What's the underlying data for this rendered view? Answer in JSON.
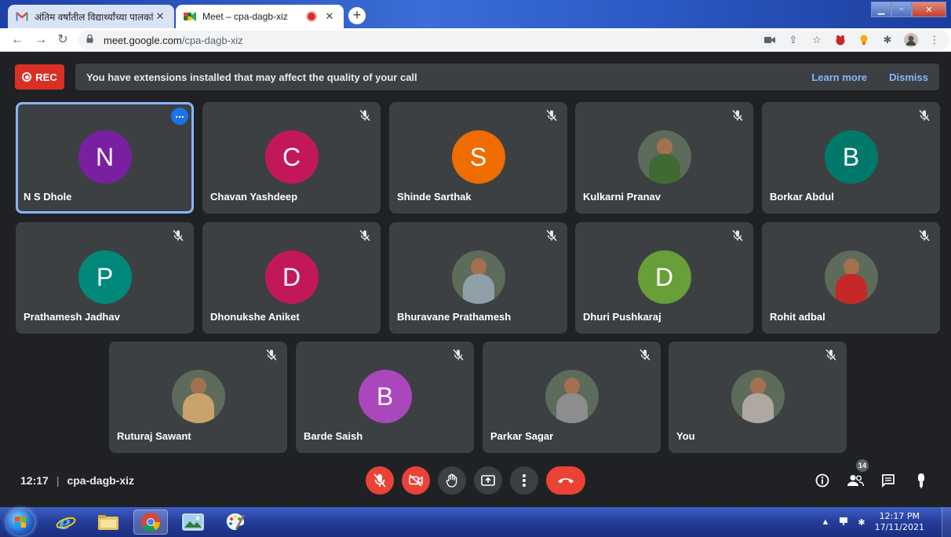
{
  "browser": {
    "tabs": [
      {
        "title": "अंतिम वर्षांतील विद्यार्थ्यांच्या पालकां",
        "icon": "gmail-icon"
      },
      {
        "title": "Meet – cpa-dagb-xiz",
        "icon": "meet-icon"
      }
    ],
    "url_host": "meet.google.com",
    "url_path": "/cpa-dagb-xiz"
  },
  "meet": {
    "rec_label": "REC",
    "banner": {
      "message": "You have extensions installed that may affect the quality of your call",
      "learn_more": "Learn more",
      "dismiss": "Dismiss"
    },
    "participants": [
      {
        "name": "N S Dhole",
        "initial": "N",
        "color": "#7b1fa2",
        "photo": false,
        "active": true
      },
      {
        "name": "Chavan Yashdeep",
        "initial": "C",
        "color": "#c2185b",
        "photo": false
      },
      {
        "name": "Shinde Sarthak",
        "initial": "S",
        "color": "#ef6c00",
        "photo": false
      },
      {
        "name": "Kulkarni Pranav",
        "initial": "",
        "color": "#3f6b33",
        "photo": true
      },
      {
        "name": "Borkar Abdul",
        "initial": "B",
        "color": "#00796b",
        "photo": false
      },
      {
        "name": "Prathamesh Jadhav",
        "initial": "P",
        "color": "#00897b",
        "photo": false
      },
      {
        "name": "Dhonukshe Aniket",
        "initial": "D",
        "color": "#c2185b",
        "photo": false
      },
      {
        "name": "Bhuravane Prathamesh",
        "initial": "",
        "color": "#8fa0a8",
        "photo": true
      },
      {
        "name": "Dhuri Pushkaraj",
        "initial": "D",
        "color": "#689f38",
        "photo": false
      },
      {
        "name": "Rohit adbal",
        "initial": "",
        "color": "#c62828",
        "photo": true
      },
      {
        "name": "Ruturaj Sawant",
        "initial": "",
        "color": "#c9a36b",
        "photo": true
      },
      {
        "name": "Barde Saish",
        "initial": "B",
        "color": "#ab47bc",
        "photo": false
      },
      {
        "name": "Parkar Sagar",
        "initial": "",
        "color": "#8d8d8d",
        "photo": true
      },
      {
        "name": "You",
        "initial": "",
        "color": "#b0a8a0",
        "photo": true
      }
    ],
    "time": "12:17",
    "meeting_code": "cpa-dagb-xiz",
    "participant_count": "14"
  },
  "taskbar": {
    "clock_time": "12:17 PM",
    "clock_date": "17/11/2021"
  }
}
